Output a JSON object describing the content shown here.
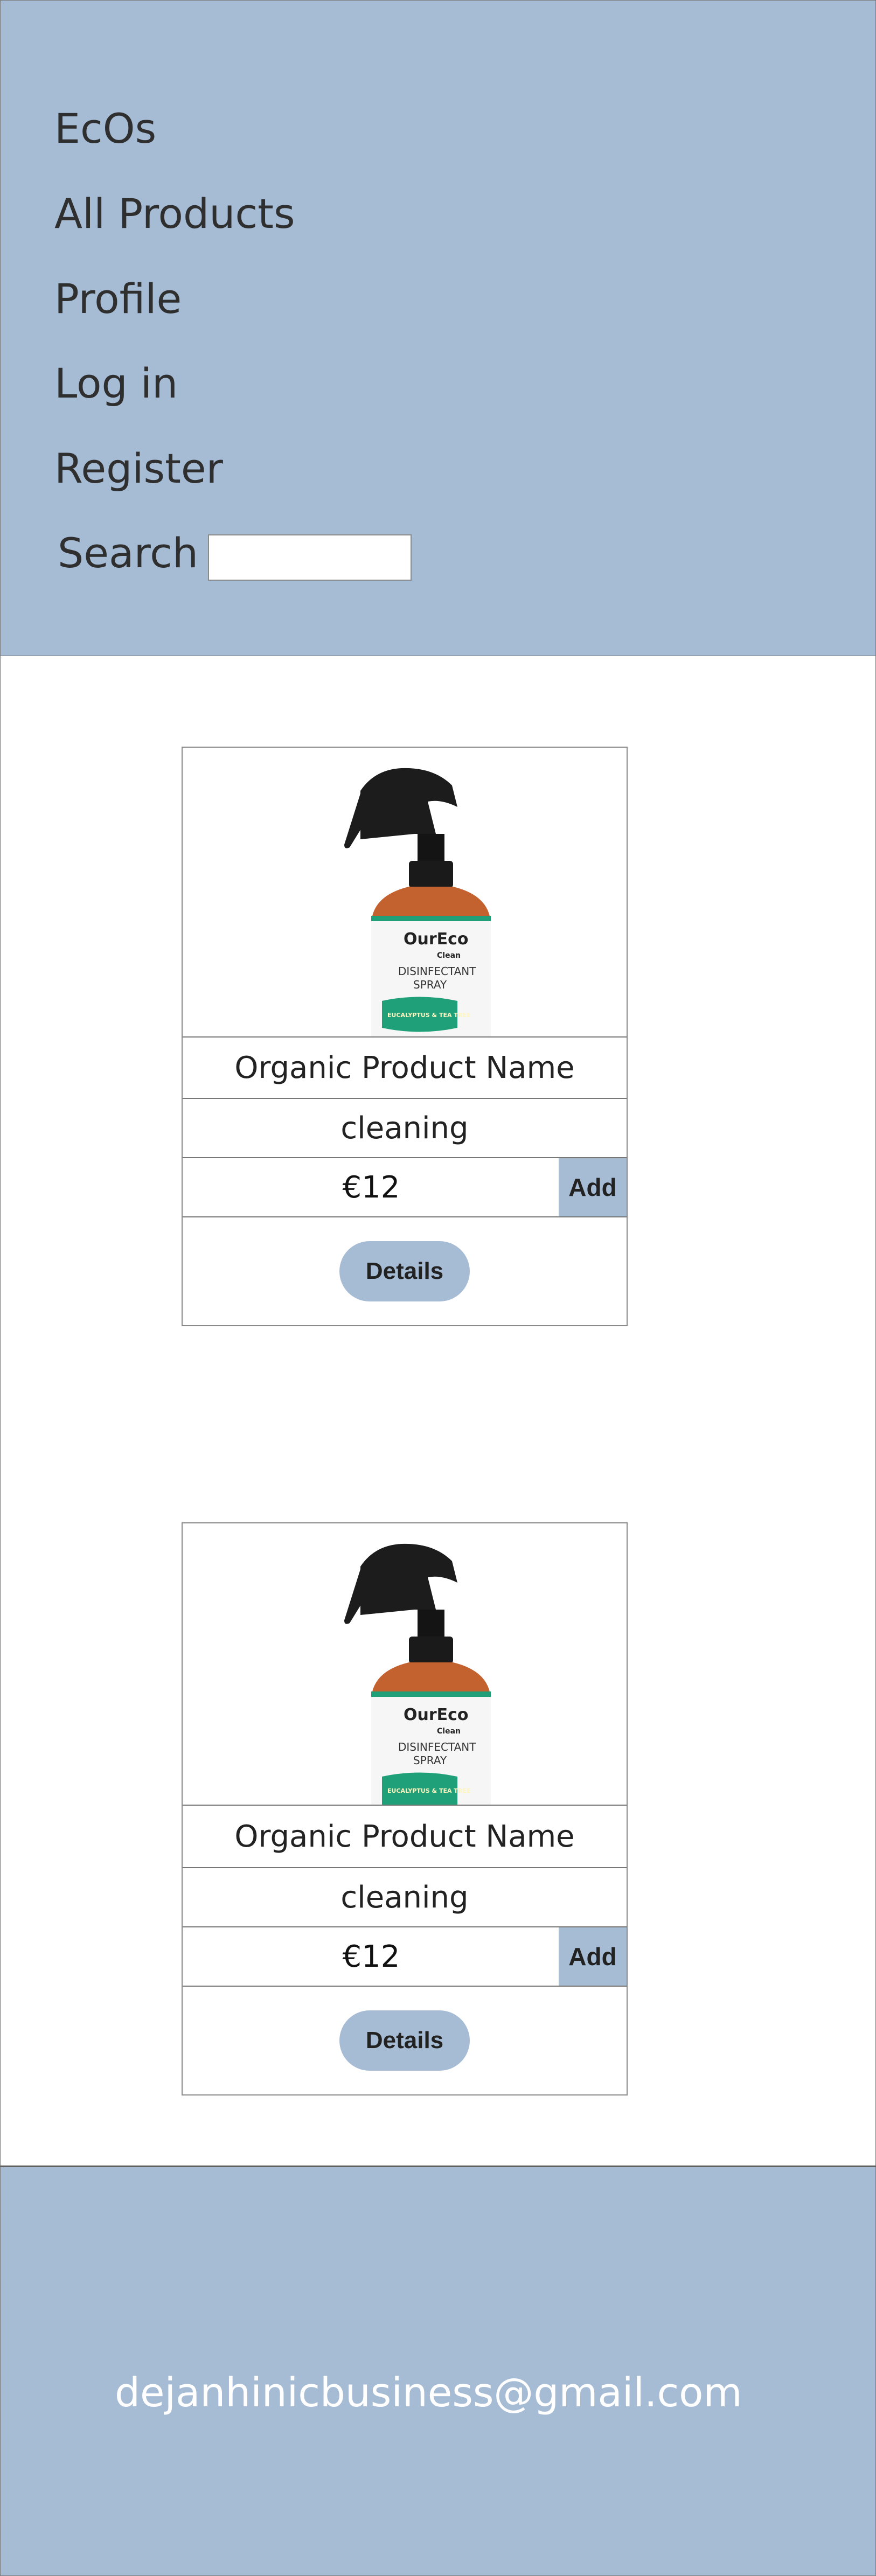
{
  "nav": {
    "brand": "EcOs",
    "all_products": "All Products",
    "profile": "Profile",
    "login": "Log in",
    "register": "Register",
    "search_label": "Search",
    "search_value": ""
  },
  "products": [
    {
      "name": "Organic Product Name",
      "category": "cleaning",
      "price": "€12",
      "add_label": "Add",
      "details_label": "Details",
      "image": {
        "brand_text": "OurEco",
        "sub_text": "Clean",
        "product_text_1": "DISINFECTANT",
        "product_text_2": "SPRAY",
        "scent_text": "EUCALYPTUS & TEA TREE"
      }
    },
    {
      "name": "Organic Product Name",
      "category": "cleaning",
      "price": "€12",
      "add_label": "Add",
      "details_label": "Details",
      "image": {
        "brand_text": "OurEco",
        "sub_text": "Clean",
        "product_text_1": "DISINFECTANT",
        "product_text_2": "SPRAY",
        "scent_text": "EUCALYPTUS & TEA TREE"
      }
    }
  ],
  "footer": {
    "email": "dejanhinicbusiness@gmail.com"
  },
  "colors": {
    "accent": "#a6bcd5",
    "bottle_orange": "#c4622f",
    "label_green": "#1fa079"
  }
}
